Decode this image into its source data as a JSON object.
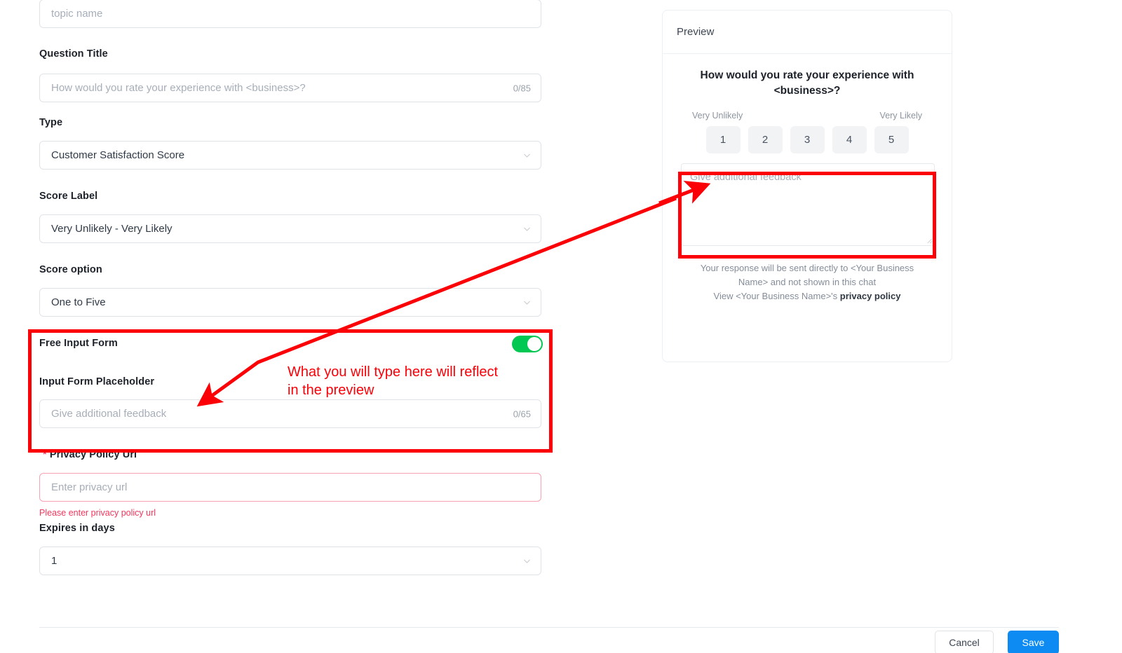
{
  "form": {
    "topic": {
      "placeholder": "topic name",
      "value": ""
    },
    "question_title": {
      "label": "Question Title",
      "placeholder": "How would you rate your experience with <business>?",
      "counter": "0/85"
    },
    "type": {
      "label": "Type",
      "value": "Customer Satisfaction Score"
    },
    "score_label": {
      "label": "Score Label",
      "value": "Very Unlikely - Very Likely"
    },
    "score_option": {
      "label": "Score option",
      "value": "One to Five"
    },
    "free_input_form": {
      "label": "Free Input Form",
      "enabled": true
    },
    "input_form_placeholder": {
      "label": "Input Form Placeholder",
      "placeholder": "Give additional feedback",
      "counter": "0/65"
    },
    "privacy_policy_url": {
      "label": "Privacy Policy Url",
      "placeholder": "Enter privacy url",
      "error": "Please enter privacy policy url"
    },
    "expires_in_days": {
      "label": "Expires in days",
      "value": "1"
    }
  },
  "preview": {
    "title": "Preview",
    "question": "How would you rate your experience with <business>?",
    "score_label_left": "Very Unlikely",
    "score_label_right": "Very Likely",
    "scores": [
      "1",
      "2",
      "3",
      "4",
      "5"
    ],
    "feedback_placeholder": "Give additional feedback",
    "footnote_line1": "Your response will be sent directly to <Your Business",
    "footnote_line2": "Name> and not shown in this chat",
    "footnote_line3_prefix": "View <Your Business Name>'s ",
    "footnote_link": "privacy policy"
  },
  "footer": {
    "cancel_label": "Cancel",
    "save_label": "Save"
  },
  "annotation": {
    "note": "What you will type here will reflect\nin the preview",
    "color": "#fb0007"
  },
  "colors": {
    "toggle_on": "#00c853",
    "primary_button": "#0d8bf2",
    "error": "#f5365c",
    "annotation_red": "#fb0007",
    "score_chip": "#f1f3f5"
  }
}
